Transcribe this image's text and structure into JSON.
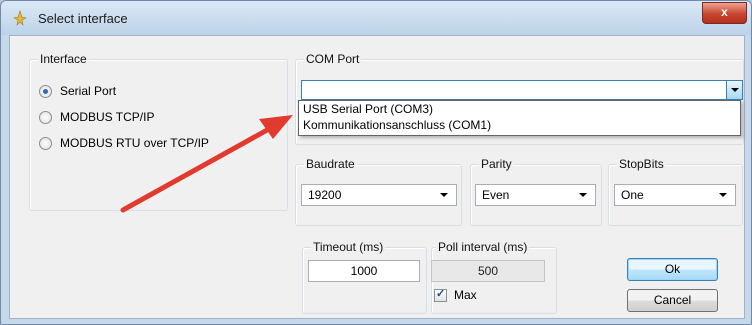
{
  "window": {
    "title": "Select interface",
    "close_label": "x"
  },
  "interface_group": {
    "label": "Interface",
    "options": [
      {
        "label": "Serial Port",
        "checked": true
      },
      {
        "label": "MODBUS TCP/IP",
        "checked": false
      },
      {
        "label": "MODBUS RTU over TCP/IP",
        "checked": false
      }
    ]
  },
  "com_port": {
    "label": "COM Port",
    "value": "",
    "options": [
      "USB Serial Port (COM3)",
      "Kommunikationsanschluss (COM1)"
    ]
  },
  "baudrate": {
    "label": "Baudrate",
    "value": "19200"
  },
  "parity": {
    "label": "Parity",
    "value": "Even"
  },
  "stopbits": {
    "label": "StopBits",
    "value": "One"
  },
  "timeout": {
    "label": "Timeout (ms)",
    "value": "1000"
  },
  "poll": {
    "label": "Poll interval (ms)",
    "value": "500",
    "max_label": "Max",
    "max_checked": true
  },
  "buttons": {
    "ok": "Ok",
    "cancel": "Cancel"
  },
  "annotation": {
    "arrow_color": "#e23a2e"
  }
}
